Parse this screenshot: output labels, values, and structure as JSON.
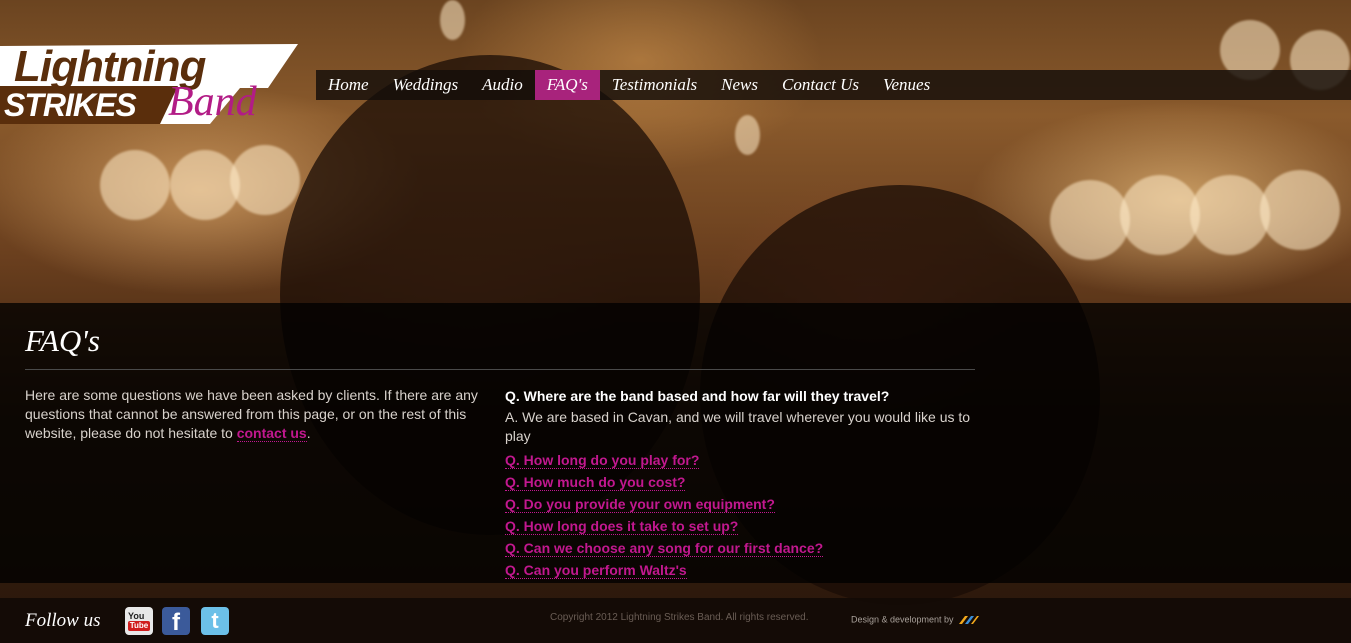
{
  "logo": {
    "line1": "Lightning",
    "line2": "STRIKES",
    "script": "Band"
  },
  "nav": {
    "items": [
      {
        "label": "Home",
        "active": false
      },
      {
        "label": "Weddings",
        "active": false
      },
      {
        "label": "Audio",
        "active": false
      },
      {
        "label": "FAQ's",
        "active": true
      },
      {
        "label": "Testimonials",
        "active": false
      },
      {
        "label": "News",
        "active": false
      },
      {
        "label": "Contact Us",
        "active": false
      },
      {
        "label": "Venues",
        "active": false
      }
    ]
  },
  "page": {
    "title": "FAQ's",
    "intro_text": "Here are some questions we have been asked by clients. If there are any questions that cannot be answered from this page, or on the rest of this website, please do not hesitate to ",
    "intro_link": "contact us",
    "intro_end": "."
  },
  "faq": {
    "open_question": "Q. Where are the band based and how far will they travel?",
    "open_answer": "A. We are based in Cavan, and we will travel wherever you would like us to play",
    "questions": [
      "Q. How long do you play for?",
      "Q. How much do you cost?",
      "Q. Do you provide your own equipment?",
      "Q. How long does it take to set up?",
      "Q. Can we choose any song for our first dance?",
      "Q. Can you perform Waltz's"
    ]
  },
  "footer": {
    "follow_label": "Follow us",
    "social": {
      "youtube": {
        "icon": "youtube-icon",
        "line1": "You",
        "line2": "Tube"
      },
      "facebook": {
        "icon": "facebook-icon",
        "glyph": "f"
      },
      "twitter": {
        "icon": "twitter-icon",
        "glyph": "t"
      }
    },
    "copyright": "Copyright 2012 Lightning Strikes Band. All rights reserved.",
    "credits": "Design & development by"
  },
  "colors": {
    "accent": "#b21c86",
    "nav_active": "#a8237c",
    "logo_brown": "#5a2e0c"
  }
}
